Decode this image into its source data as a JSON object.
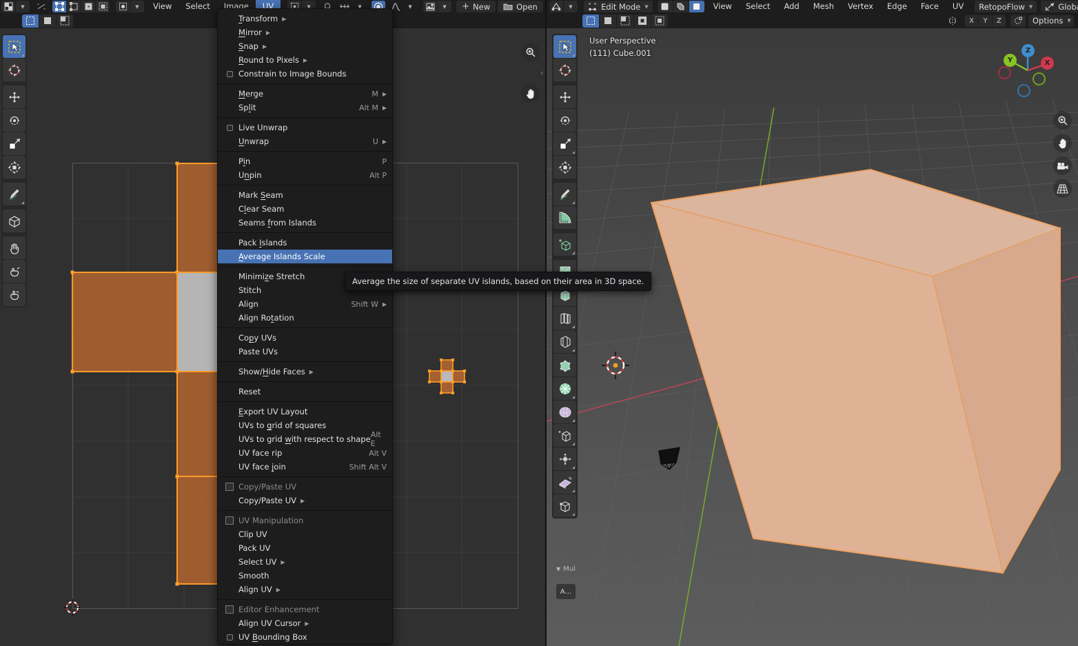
{
  "app": "Blender",
  "uv_editor": {
    "header_menus": [
      "View",
      "Select",
      "Image",
      "UV"
    ],
    "active_menu": "UV",
    "editor_type_icon": "uv-editor-icon",
    "pivot_icon": "pivot-point-icon",
    "sync_icon": "uv-sync-selection-icon",
    "select_mode_icons": [
      "vertex-select-icon",
      "edge-select-icon",
      "face-select-icon",
      "island-select-icon"
    ],
    "sticky_icon": "sticky-selection-icon",
    "image_new_label": "New",
    "image_open_label": "Open",
    "pin_icon": "pin-icon",
    "snap_icon": "snap-magnet-icon",
    "proportional_icon": "proportional-editing-icon",
    "mode_row_icons": [
      "tweak-select-icon",
      "box-select-icon",
      "circle-select-icon"
    ]
  },
  "viewport": {
    "mode_label": "Edit Mode",
    "mode_icon": "edit-mode-icon",
    "mesh_select_modes": [
      "vertex-select-icon",
      "edge-select-icon",
      "face-select-icon"
    ],
    "active_select_mode": 2,
    "menus": [
      "View",
      "Select",
      "Add",
      "Mesh",
      "Vertex",
      "Edge",
      "Face",
      "UV"
    ],
    "retopoflow_label": "RetopoFlow",
    "transform_orientation": "Global",
    "orientation_icon": "orientation-axis-icon",
    "snap_icon": "snap-magnet-icon",
    "proportional_icon": "proportional-editing-icon",
    "mirror_icon": "mirror-icon",
    "mirror_axes": [
      "X",
      "Y",
      "Z"
    ],
    "options_label": "Options",
    "overlay_line1": "User Perspective",
    "overlay_line2": "(111) Cube.001",
    "object_name": "Cube.001",
    "gizmo_axes": [
      {
        "label": "Z",
        "color": "#3e8fd0"
      },
      {
        "label": "Y",
        "color": "#87c524"
      },
      {
        "label": "X",
        "color": "#d0384f"
      }
    ],
    "nav_buttons": [
      "zoom-icon",
      "pan-hand-icon",
      "camera-icon",
      "grid-perspective-icon"
    ],
    "select_mode_row_icons": [
      "tweak-select-icon",
      "box-select-icon",
      "circle-select-icon",
      "lasso-select-icon",
      "select-box-icon"
    ]
  },
  "uv_menu": {
    "title": "UV",
    "sections": [
      {
        "items": [
          {
            "label": "Transform",
            "accel": "T",
            "submenu": true
          },
          {
            "label": "Mirror",
            "accel": "M",
            "submenu": true
          },
          {
            "label": "Snap",
            "accel": "S",
            "submenu": true
          },
          {
            "label": "Round to Pixels",
            "accel": "R",
            "submenu": true
          },
          {
            "label": "Constrain to Image Bounds",
            "checkbox": true,
            "checked": false
          }
        ]
      },
      {
        "items": [
          {
            "label": "Merge",
            "accel": "M",
            "shortcut": "M",
            "submenu": true
          },
          {
            "label": "Split",
            "accel": "l",
            "shortcut": "Alt M",
            "submenu": true
          }
        ]
      },
      {
        "items": [
          {
            "label": "Live Unwrap",
            "checkbox": true,
            "checked": false
          },
          {
            "label": "Unwrap",
            "accel": "U",
            "shortcut": "U",
            "submenu": true
          }
        ]
      },
      {
        "items": [
          {
            "label": "Pin",
            "accel": "i",
            "shortcut": "P"
          },
          {
            "label": "Unpin",
            "accel": "n",
            "shortcut": "Alt P"
          }
        ]
      },
      {
        "items": [
          {
            "label": "Mark Seam",
            "accel": "S"
          },
          {
            "label": "Clear Seam",
            "accel": "l"
          },
          {
            "label": "Seams from Islands",
            "accel": "f"
          }
        ]
      },
      {
        "items": [
          {
            "label": "Pack Islands",
            "accel": "I"
          },
          {
            "label": "Average Islands Scale",
            "accel": "A",
            "selected": true
          }
        ]
      },
      {
        "items": [
          {
            "label": "Minimize Stretch",
            "accel": "z"
          },
          {
            "label": "Stitch"
          },
          {
            "label": "Align",
            "shortcut": "Shift W",
            "submenu": true
          },
          {
            "label": "Align Rotation",
            "accel": "t"
          }
        ]
      },
      {
        "items": [
          {
            "label": "Copy UVs",
            "accel": "p"
          },
          {
            "label": "Paste UVs"
          }
        ]
      },
      {
        "items": [
          {
            "label": "Show/Hide Faces",
            "accel": "H",
            "submenu": true
          }
        ]
      },
      {
        "items": [
          {
            "label": "Reset"
          }
        ]
      },
      {
        "items": [
          {
            "label": "Export UV Layout",
            "accel": "E"
          },
          {
            "label": "UVs to grid of squares",
            "accel": "g"
          },
          {
            "label": "UVs to grid with respect to shape",
            "accel": "w",
            "shortcut": "Alt E"
          },
          {
            "label": "UV face rip",
            "shortcut": "Alt V"
          },
          {
            "label": "UV face join",
            "accel": "j",
            "shortcut": "Shift Alt V"
          }
        ]
      },
      {
        "addon_header": "Copy/Paste UV",
        "items": [
          {
            "label": "Copy/Paste UV",
            "submenu": true
          }
        ]
      },
      {
        "addon_header": "UV Manipulation",
        "items": [
          {
            "label": "Clip UV"
          },
          {
            "label": "Pack UV"
          },
          {
            "label": "Select UV",
            "submenu": true
          },
          {
            "label": "Smooth"
          },
          {
            "label": "Align UV",
            "submenu": true
          }
        ]
      },
      {
        "addon_header": "Editor Enhancement",
        "items": [
          {
            "label": "Align UV Cursor",
            "submenu": true
          },
          {
            "label": "UV Bounding Box",
            "accel": "B",
            "checkbox": true,
            "checked": false
          }
        ]
      }
    ]
  },
  "tooltip": {
    "text": "Average the size of separate UV islands, based on their area in 3D space."
  },
  "uv_toolbar": {
    "tools": [
      {
        "name": "tweak-tool",
        "icon": "cursor-arrow-icon",
        "active": true
      },
      {
        "name": "cursor-tool",
        "icon": "2d-cursor-icon"
      },
      {
        "name": "move-tool",
        "icon": "move-arrows-icon"
      },
      {
        "name": "rotate-tool",
        "icon": "rotate-icon"
      },
      {
        "name": "scale-tool",
        "icon": "scale-icon"
      },
      {
        "name": "transform-tool",
        "icon": "transform-icon"
      },
      {
        "name": "annotate-tool",
        "icon": "pencil-icon"
      },
      {
        "name": "uv-sculpt-grab",
        "icon": "cube-uv-icon"
      },
      {
        "name": "grab-brush-tool",
        "icon": "hand-grab-icon"
      },
      {
        "name": "relax-brush-tool",
        "icon": "hand-relax-icon"
      },
      {
        "name": "pinch-brush-tool",
        "icon": "hand-pinch-icon"
      }
    ]
  },
  "viewport_toolbar": {
    "tools": [
      {
        "name": "tweak-tool",
        "icon": "cursor-arrow-icon",
        "active": true
      },
      {
        "name": "cursor-tool",
        "icon": "3d-cursor-icon"
      },
      {
        "name": "move-tool",
        "icon": "move-arrows-icon"
      },
      {
        "name": "rotate-tool",
        "icon": "rotate-icon"
      },
      {
        "name": "scale-tool",
        "icon": "scale-icon"
      },
      {
        "name": "transform-tool",
        "icon": "transform-icon"
      },
      {
        "name": "annotate-tool",
        "icon": "pencil-icon"
      },
      {
        "name": "measure-tool",
        "icon": "ruler-icon"
      },
      {
        "name": "add-cube-tool",
        "icon": "add-cube-icon"
      },
      {
        "name": "extrude-region-tool",
        "icon": "extrude-region-icon"
      },
      {
        "name": "inset-faces-tool",
        "icon": "inset-faces-icon"
      },
      {
        "name": "bevel-tool",
        "icon": "bevel-icon"
      },
      {
        "name": "loop-cut-tool",
        "icon": "loop-cut-icon"
      },
      {
        "name": "knife-tool",
        "icon": "knife-icon"
      },
      {
        "name": "poly-build-tool",
        "icon": "poly-build-icon"
      },
      {
        "name": "spin-tool",
        "icon": "spin-icon"
      },
      {
        "name": "smooth-tool",
        "icon": "smooth-icon"
      },
      {
        "name": "edge-slide-tool",
        "icon": "edge-slide-icon"
      },
      {
        "name": "shrink-fatten-tool",
        "icon": "shrink-fatten-icon"
      },
      {
        "name": "shear-tool",
        "icon": "shear-icon"
      },
      {
        "name": "rip-region-tool",
        "icon": "rip-region-icon"
      }
    ],
    "collapse_label": "Mul",
    "annotate_label": "A..."
  },
  "colors": {
    "accent_blue": "#4772b3",
    "uv_face_selected": "#a5602f",
    "uv_edge": "#ff9b28",
    "uv_face_unselected": "#b5b5b5",
    "mesh_selected": "#e0b295",
    "axis_x": "#c4465c",
    "axis_y": "#7aab26",
    "background_editor": "#303030",
    "background_header": "#1d1d1d"
  }
}
